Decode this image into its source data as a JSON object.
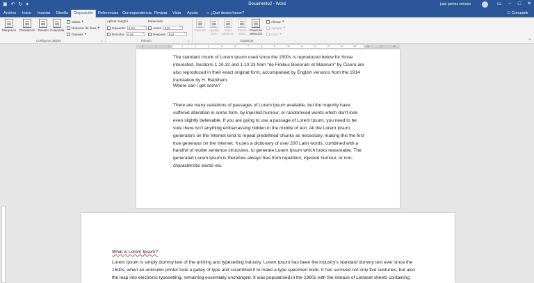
{
  "titlebar": {
    "title": "Documento2 - Word",
    "user": "juan gomez serrano",
    "qat": [
      "save-icon",
      "undo-icon",
      "redo-icon",
      "customize-icon"
    ]
  },
  "tabs": [
    {
      "label": "Archivo",
      "active": false
    },
    {
      "label": "Inicio",
      "active": false
    },
    {
      "label": "Insertar",
      "active": false
    },
    {
      "label": "Diseño",
      "active": false
    },
    {
      "label": "Disposición",
      "active": true
    },
    {
      "label": "Referencias",
      "active": false
    },
    {
      "label": "Correspondencia",
      "active": false
    },
    {
      "label": "Revisar",
      "active": false
    },
    {
      "label": "Vista",
      "active": false
    },
    {
      "label": "Ayuda",
      "active": false
    },
    {
      "label": "¿Qué desea hacer?",
      "active": false
    }
  ],
  "share_label": "Compartir",
  "ribbon": {
    "configurar": {
      "group_label": "Configurar página",
      "buttons": [
        "Márgenes",
        "Orientación",
        "Tamaño",
        "Columnas"
      ],
      "saltos": "Saltos",
      "numeros": "Números de línea",
      "guiones": "Guiones"
    },
    "parrafo": {
      "group_label": "Párrafo",
      "aplicar_sangria": "Aplicar sangría",
      "izquierda_label": "Izquierda:",
      "izquierda_value": "0 cm",
      "derecha_label": "Derecha:",
      "derecha_value": "0 cm",
      "espaciado": "Espaciado",
      "antes_label": "Antes:",
      "antes_value": "0 pt",
      "despues_label": "Después:",
      "despues_value": "8 pt"
    },
    "organizar": {
      "group_label": "Organizar",
      "buttons": [
        "Posición",
        "Ajustar texto",
        "Traer adelante",
        "Enviar atrás",
        "Panel de selección"
      ],
      "alinear": "Alinear",
      "agrupar": "Agrupar",
      "girar": "Girar"
    }
  },
  "ruler_numbers": [
    "2",
    "1",
    "1",
    "2",
    "3",
    "4",
    "5",
    "6",
    "7",
    "8",
    "9",
    "10",
    "11",
    "12",
    "13",
    "14",
    "15",
    "16",
    "17",
    "18"
  ],
  "page1": {
    "para1": "The standard chunk of Lorem Ipsum used since the 1500s is reproduced below for those interested. Sections 1.10.32 and 1.10.33 from \"de Finibus Bonorum et Malorum\" by Cicero are also reproduced in their exact original form, accompanied by English versions from the 1914 translation by H. Rackham.",
    "para2": "Where can I get some?",
    "para3": "There are many variations of passages of Lorem Ipsum available, but the majority have suffered alteration in some form, by injected humour, or randomised words which don't look even slightly believable. If you are going to use a passage of Lorem Ipsum, you need to be sure there isn't anything embarrassing hidden in the middle of text. All the Lorem Ipsum generators on the Internet tend to repeat predefined chunks as necessary, making this the first true generator on the Internet. It uses a dictionary of over 200 Latin words, combined with a handful of model sentence structures, to generate Lorem Ipsum which looks reasonable. The generated Lorem Ipsum is therefore always free from repetition, injected humour, or non-characteristic words etc."
  },
  "page2": {
    "title": "What is Lorem Ipsum?",
    "body": "Lorem Ipsum is simply dummy text of the printing and typesetting industry. Lorem Ipsum has been the industry's standard dummy text ever since the 1500s, when an unknown printer took a galley of type and scrambled it to make a type specimen book. It has survived not only five centuries, but also the leap into electronic typesetting, remaining essentially unchanged. It was popularised in the 1960s with the release of Letraset sheets containing Lorem Ipsum passages, and more recently with desktop publishing software like Aldus PageMaker including versions of Lorem Ipsum."
  }
}
